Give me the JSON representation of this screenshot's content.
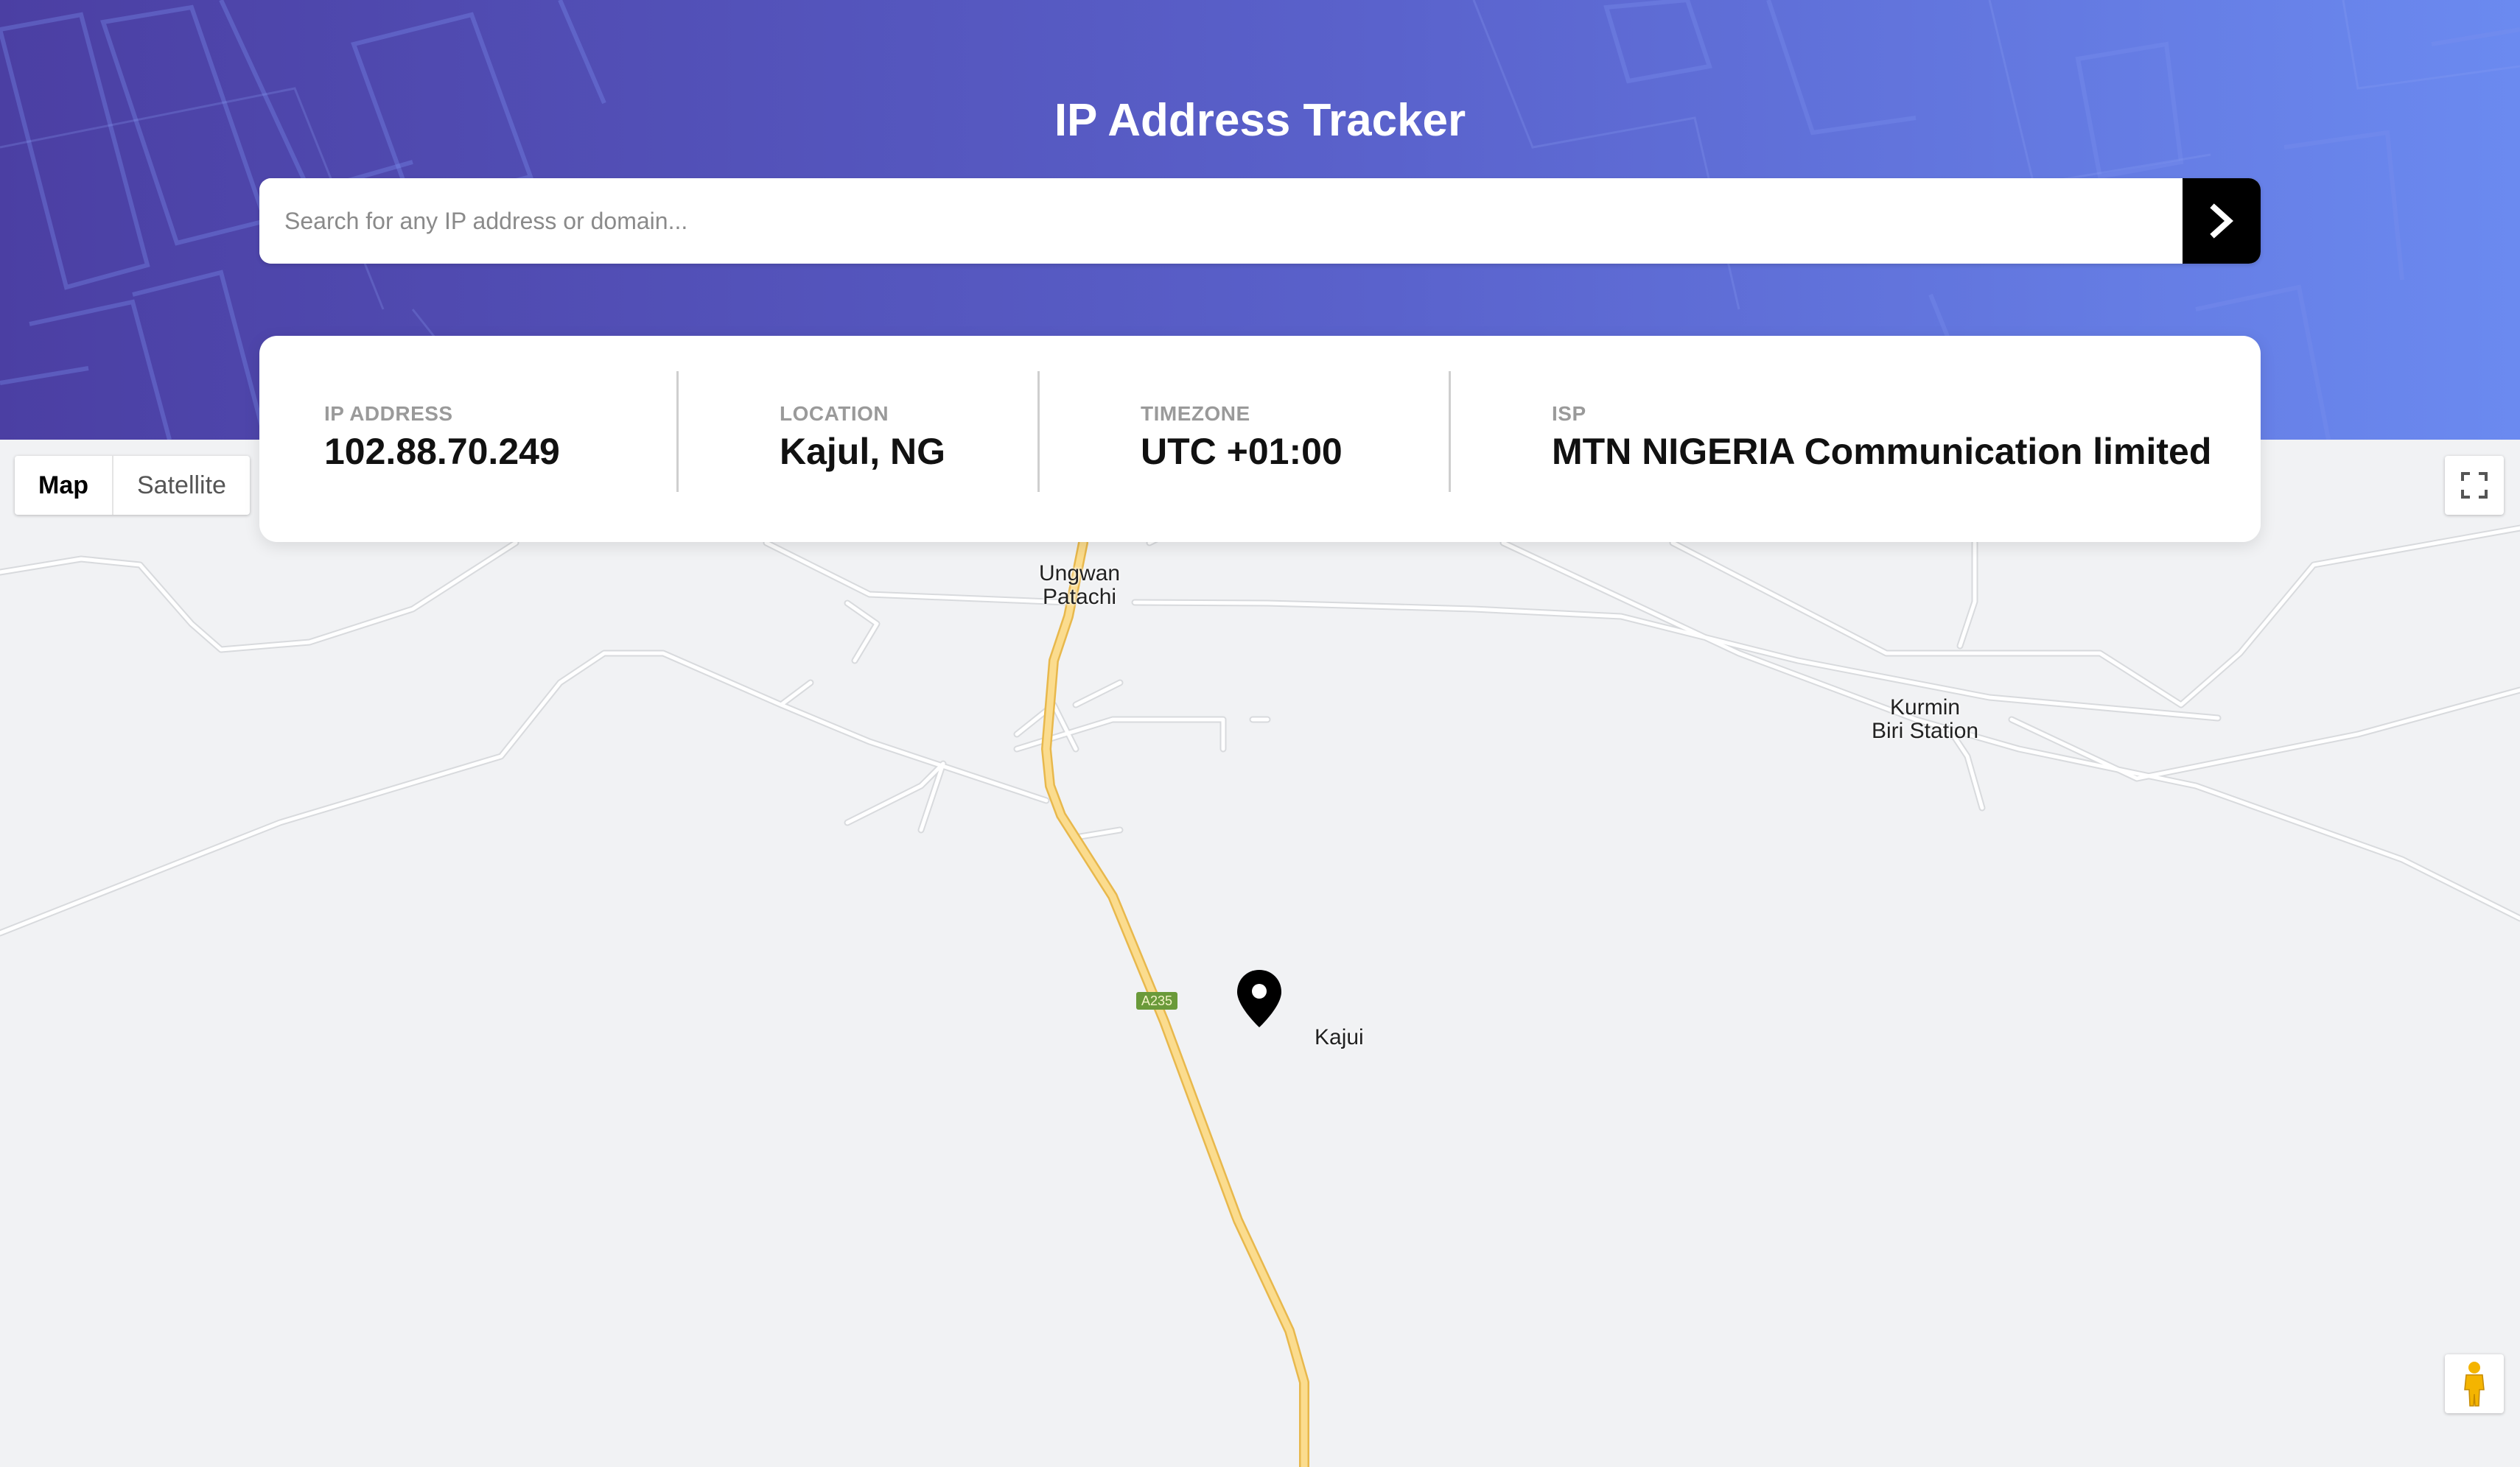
{
  "app": {
    "title": "IP Address Tracker"
  },
  "search": {
    "placeholder": "Search for any IP address or domain...",
    "value": "",
    "submit_icon": "chevron-right-icon"
  },
  "info": {
    "ip": {
      "label": "IP ADDRESS",
      "value": "102.88.70.249"
    },
    "location": {
      "label": "LOCATION",
      "value": "Kajul, NG"
    },
    "timezone": {
      "label": "TIMEZONE",
      "value": "UTC +01:00"
    },
    "isp": {
      "label": "ISP",
      "value": "MTN NIGERIA Communication limited"
    }
  },
  "map": {
    "type_options": [
      "Map",
      "Satellite"
    ],
    "selected_type": "Map",
    "labels": {
      "place_1": [
        "Ungwan",
        "Patachi"
      ],
      "place_2": [
        "Kurmin",
        "Biri Station"
      ],
      "marker_place": "Kajui",
      "road_shield": "A235"
    },
    "icons": {
      "marker": "map-pin-icon",
      "fullscreen": "fullscreen-icon",
      "street_view": "pegman-icon"
    }
  },
  "colors": {
    "header_gradient_start": "#4b3fa3",
    "header_gradient_end": "#6b8af0",
    "search_button": "#000000",
    "road_major": "#f6d37a",
    "map_background": "#f1f2f4"
  }
}
